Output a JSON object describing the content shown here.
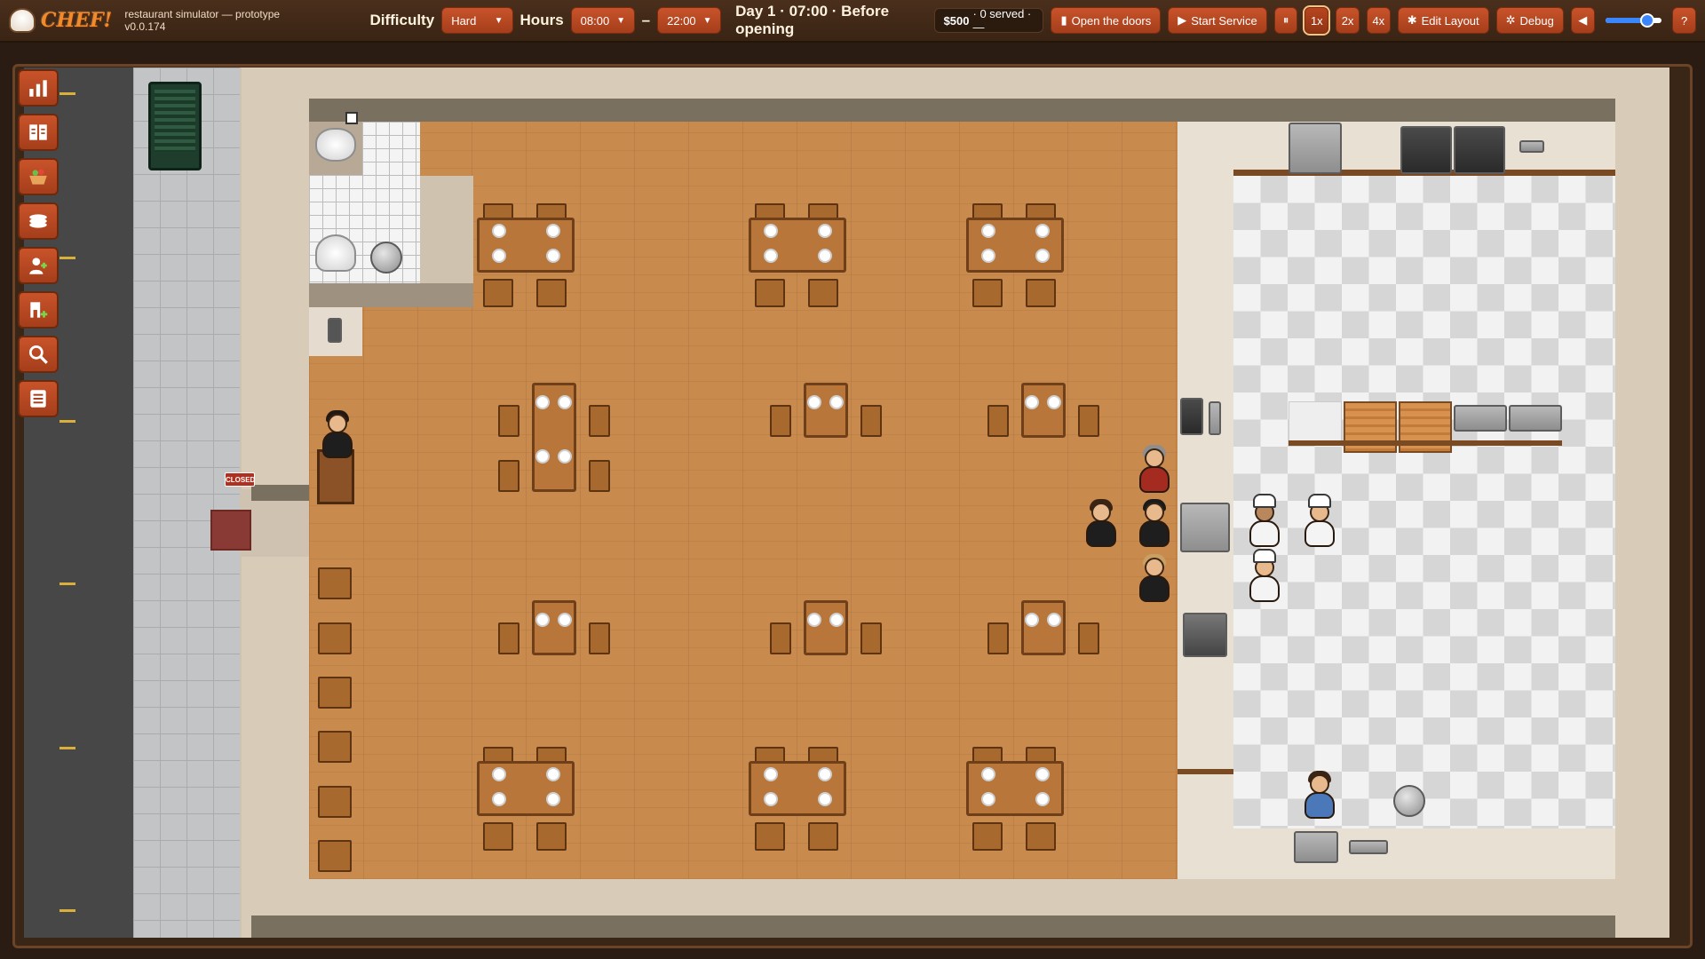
{
  "app": {
    "logo_text": "CHEF!",
    "subtitle": "restaurant simulator — prototype v0.0.174"
  },
  "toolbar": {
    "difficulty_label": "Difficulty",
    "difficulty_value": "Hard",
    "hours_label": "Hours",
    "open_hour": "08:00",
    "hours_dash": "–",
    "close_hour": "22:00",
    "day_status": "Day 1 · 07:00 · Before opening",
    "money": "$500",
    "served": "· 0 served · —",
    "open_doors_label": "Open the doors",
    "start_service_label": "Start Service",
    "pause_label": "⏸",
    "speed_1x": "1x",
    "speed_2x": "2x",
    "speed_4x": "4x",
    "edit_layout_label": "Edit Layout",
    "debug_label": "Debug",
    "mute_icon": "speaker-icon",
    "help_label": "?",
    "volume_level": 0.75
  },
  "sign": {
    "closed": "CLOSED"
  },
  "sidebar": {
    "items": [
      {
        "icon": "bar-chart-icon"
      },
      {
        "icon": "menu-book-icon"
      },
      {
        "icon": "ingredients-basket-icon"
      },
      {
        "icon": "plates-stack-icon"
      },
      {
        "icon": "hire-staff-icon"
      },
      {
        "icon": "add-furniture-icon"
      },
      {
        "icon": "magnifier-icon"
      },
      {
        "icon": "list-icon"
      }
    ]
  },
  "colors": {
    "accent": "#c8532a",
    "floor": "#c98a4e",
    "topbar": "#3a2414"
  }
}
